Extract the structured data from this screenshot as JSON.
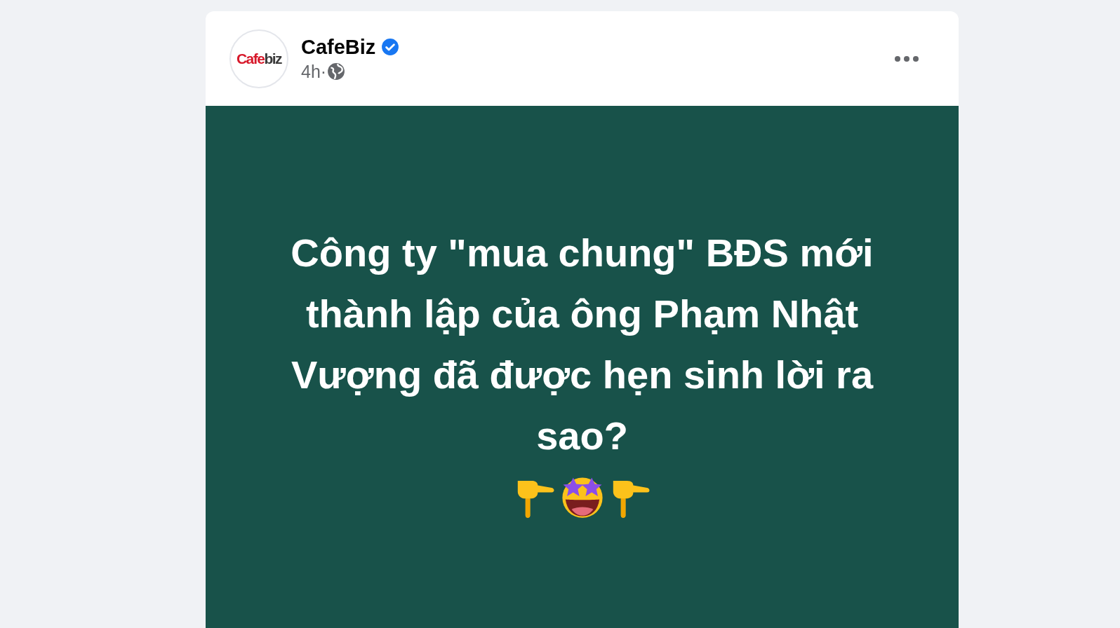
{
  "post": {
    "page_name": "CafeBiz",
    "verified": true,
    "avatar_logo": {
      "part_1": "Cafe",
      "part_2": "biz"
    },
    "time": "4h·",
    "public": true
  },
  "text_background": {
    "text": "Công ty \"mua chung\" BĐS mới thành lập của ông Phạm Nhật Vượng đã được hẹn sinh lời ra sao?",
    "emojis": [
      {
        "kind": "point-down"
      },
      {
        "kind": "star-struck"
      },
      {
        "kind": "point-down"
      }
    ]
  }
}
